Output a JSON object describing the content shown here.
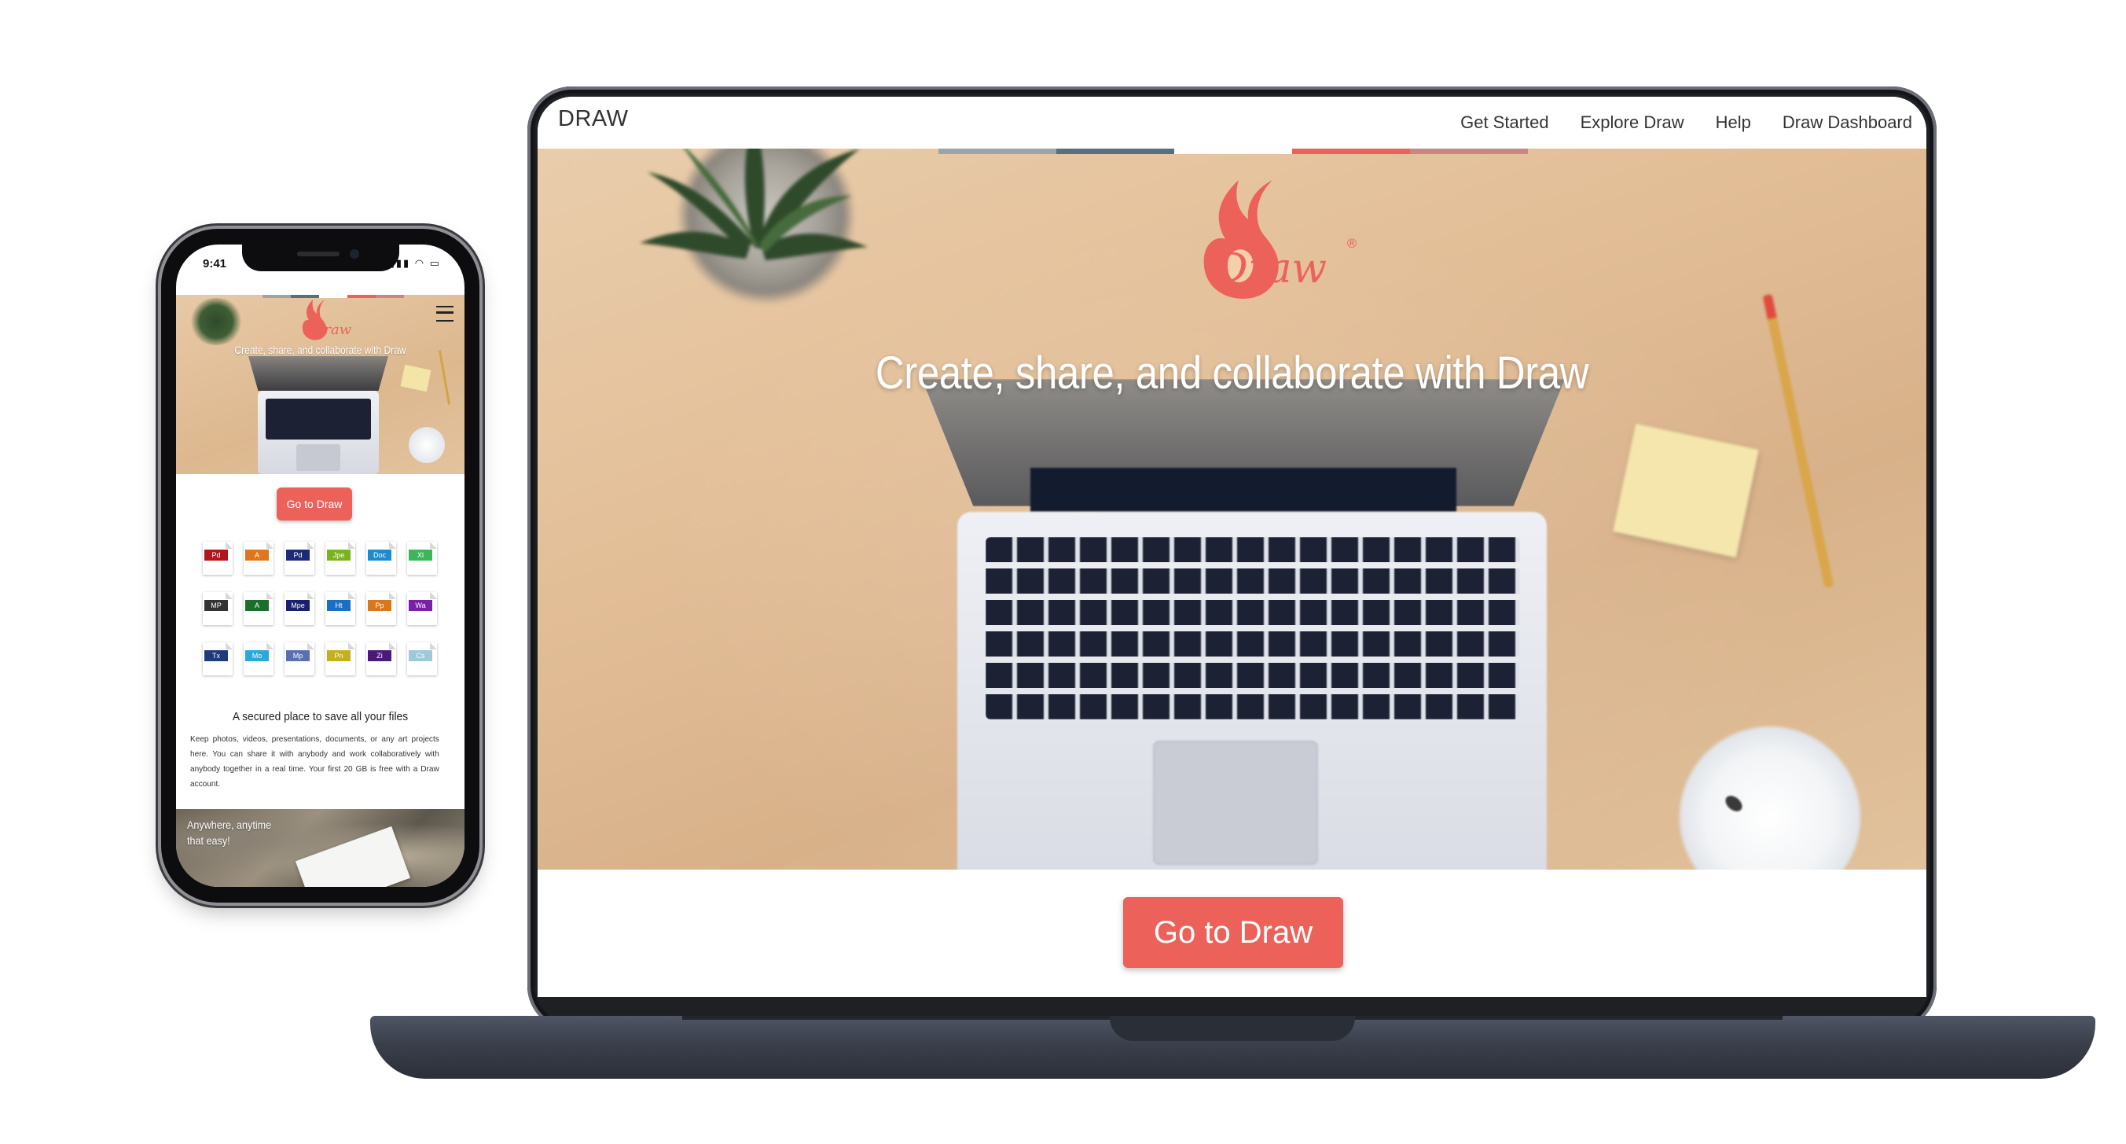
{
  "desktop": {
    "nav": {
      "brand": "DRAW",
      "links": [
        "Get Started",
        "Explore Draw",
        "Help",
        "Draw Dashboard"
      ]
    },
    "hero": {
      "headline": "Create, share, and collaborate with Draw",
      "logo_text": "Draw",
      "logo_mark": "®",
      "stripe_colors": [
        "#9aa4aa",
        "#55707f",
        "#ffffff",
        "#ec625a",
        "#c88783"
      ]
    },
    "cta_label": "Go to Draw"
  },
  "mobile": {
    "status_time": "9:41",
    "status_icons": "▮▮▮ ◠ ▭",
    "hero_headline": "Create, share, and collaborate with Draw",
    "logo_text": "Draw",
    "cta_label": "Go to Draw",
    "file_types": [
      {
        "label": "Pd",
        "color": "#b0161b"
      },
      {
        "label": "A",
        "color": "#e0761c"
      },
      {
        "label": "Pd",
        "color": "#1c2a7a"
      },
      {
        "label": "Jpe",
        "color": "#7ab41d"
      },
      {
        "label": "Doc",
        "color": "#1d8bd0"
      },
      {
        "label": "Xl",
        "color": "#3db55a"
      },
      {
        "label": "MP",
        "color": "#333333"
      },
      {
        "label": "A",
        "color": "#1c6e2b"
      },
      {
        "label": "Mpe",
        "color": "#1a1f6e"
      },
      {
        "label": "Ht",
        "color": "#1a6fc4"
      },
      {
        "label": "Pp",
        "color": "#d9761e"
      },
      {
        "label": "Wa",
        "color": "#7a1fa8"
      },
      {
        "label": "Tx",
        "color": "#1f3a7a"
      },
      {
        "label": "Mo",
        "color": "#2aa8d9"
      },
      {
        "label": "Mp",
        "color": "#5a6fb0"
      },
      {
        "label": "Pn",
        "color": "#c4b01c"
      },
      {
        "label": "Zi",
        "color": "#4a1a7a"
      },
      {
        "label": "Cs",
        "color": "#9ec9d9"
      }
    ],
    "subtitle": "A secured place to save all your files",
    "body": "Keep photos, videos, presentations, documents, or any art projects here. You can share it with anybody and work collaboratively with anybody together in a real time. Your first 20 GB is free with a Draw account.",
    "footer_line1": "Anywhere, anytime",
    "footer_line2": "that easy!"
  },
  "colors": {
    "accent": "#ec625a",
    "device_dark": "#2b2f39"
  }
}
